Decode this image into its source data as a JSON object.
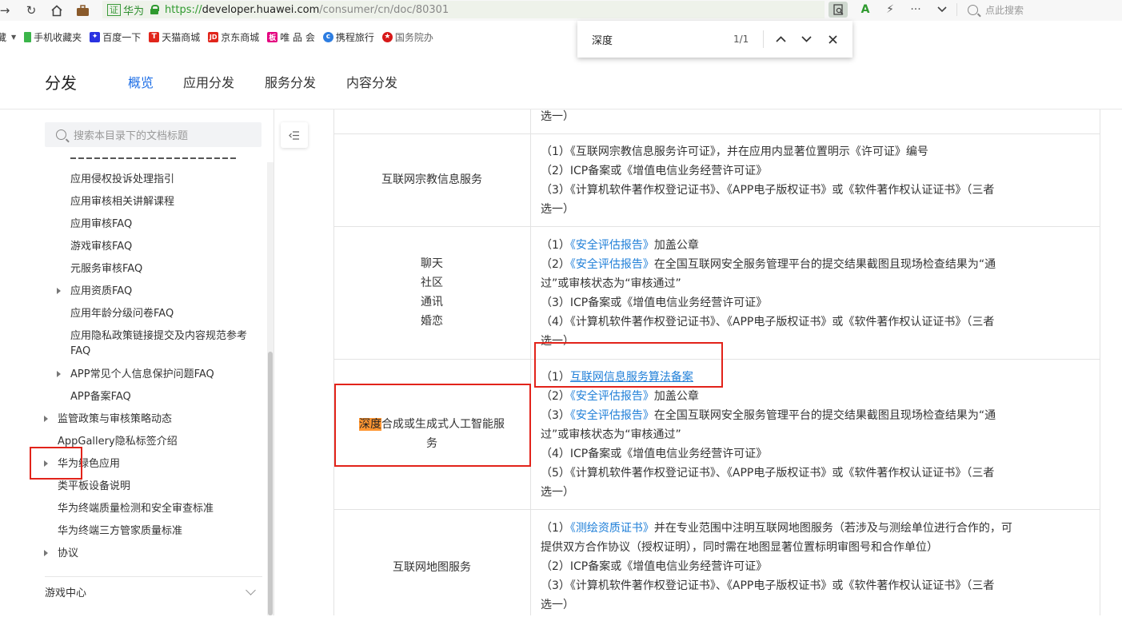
{
  "browser": {
    "cert_label": "证",
    "site_name": "华为",
    "url_scheme": "https://",
    "url_host": "developer.huawei.com",
    "url_path": "/consumer/cn/doc/80301",
    "search_placeholder": "点此搜索",
    "bookmarks": [
      {
        "label": "藏",
        "icon": "star-icon",
        "color": "#f0b400"
      },
      {
        "label": "手机收藏夹",
        "icon": "phone-icon",
        "color": "#3bb54a"
      },
      {
        "label": "百度一下",
        "icon": "baidu-paw-icon",
        "color": "#2932e1"
      },
      {
        "label": "天猫商城",
        "icon": "tmall-icon",
        "color": "#e1251b"
      },
      {
        "label": "京东商城",
        "icon": "jd-icon",
        "color": "#e1251b"
      },
      {
        "label": "唯 品 会",
        "icon": "vip-icon",
        "color": "#e4007f"
      },
      {
        "label": "携程旅行",
        "icon": "ctrip-icon",
        "color": "#2d7de1"
      },
      {
        "label": "国务院办",
        "icon": "emblem-icon",
        "color": "#d71818"
      }
    ]
  },
  "findbar": {
    "query": "深度",
    "count": "1/1"
  },
  "header": {
    "brand": "分发",
    "nav": [
      "概览",
      "应用分发",
      "服务分发",
      "内容分发"
    ],
    "active_index": 0
  },
  "sidebar": {
    "search_placeholder": "搜索本目录下的文档标题",
    "items": [
      {
        "label": "应用侵权投诉处理指引"
      },
      {
        "label": "应用审核相关讲解课程"
      },
      {
        "label": "应用审核FAQ"
      },
      {
        "label": "游戏审核FAQ"
      },
      {
        "label": "元服务审核FAQ"
      },
      {
        "label": "应用资质FAQ"
      },
      {
        "label": "应用年龄分级问卷FAQ"
      },
      {
        "label": "应用隐私政策链接提交及内容规范参考"
      },
      {
        "label": "FAQ"
      },
      {
        "label": "APP常见个人信息保护问题FAQ"
      },
      {
        "label": "APP备案FAQ"
      },
      {
        "label": "监管政策与审核策略动态"
      },
      {
        "label": "AppGallery隐私标签介绍"
      },
      {
        "label": "华为绿色应用"
      },
      {
        "label": "类平板设备说明"
      },
      {
        "label": "华为终端质量检测和安全审查标准"
      },
      {
        "label": "华为终端三方管家质量标准"
      },
      {
        "label": "协议"
      }
    ],
    "game_center": "游戏中心"
  },
  "table": {
    "row0": {
      "tail": "选一）"
    },
    "row1": {
      "category": "互联网宗教信息服务",
      "lines": [
        "（1）《互联网宗教信息服务许可证》，并在应用内显著位置明示《许可证》编号",
        "（2）ICP备案或《增值电信业务经营许可证》",
        "（3）《计算机软件著作权登记证书》、《APP电子版权证书》或《软件著作权认证证书》（三者",
        "选一）"
      ]
    },
    "row2": {
      "categories": [
        "聊天",
        "社区",
        "通讯",
        "婚恋"
      ],
      "l1_pre": "（1）",
      "l1_link": "《安全评估报告》",
      "l1_post": "加盖公章",
      "l2_pre": "（2）",
      "l2_link": "《安全评估报告》",
      "l2_post": "在全国互联网安全服务管理平台的提交结果截图且现场检查结果为“通",
      "l3": "过”或审核状态为“审核通过”",
      "l4": "（3）ICP备案或《增值电信业务经营许可证》",
      "l5": "（4）《计算机软件著作权登记证书》、《APP电子版权证书》或《软件著作权认证证书》（三者",
      "l6": "选一）"
    },
    "row3": {
      "cat_highlight": "深度",
      "cat_rest_1": "合成或生成式人工智能服",
      "cat_rest_2": "务",
      "l1_pre": "（1）",
      "l1_link": "互联网信息服务算法备案",
      "l2_pre": "（2）",
      "l2_link": "《安全评估报告》",
      "l2_post": "加盖公章",
      "l3_pre": "（3）",
      "l3_link": "《安全评估报告》",
      "l3_post": "在全国互联网安全服务管理平台的提交结果截图且现场检查结果为“通",
      "l4": "过”或审核状态为“审核通过”",
      "l5": "（4）ICP备案或《增值电信业务经营许可证》",
      "l6": "（5）《计算机软件著作权登记证书》、《APP电子版权证书》或《软件著作权认证证书》（三者",
      "l7": "选一）"
    },
    "row4": {
      "category": "互联网地图服务",
      "l1_pre": "（1）",
      "l1_link": "《测绘资质证书》",
      "l1_post": "并在专业范围中注明互联网地图服务（若涉及与测绘单位进行合作的，可",
      "l2": "提供双方合作协议（授权证明），同时需在地图显著位置标明审图号和合作单位）",
      "l3": "（2）ICP备案或《增值电信业务经营许可证》",
      "l4": "（3）《计算机软件著作权登记证书》、《APP电子版权证书》或《软件著作权认证证书》（三者",
      "l5": "选一）"
    }
  },
  "colors": {
    "accent": "#1f6fe6",
    "link": "#1f7fd8",
    "highlight": "#ff9632",
    "annotation": "#e2231a"
  }
}
